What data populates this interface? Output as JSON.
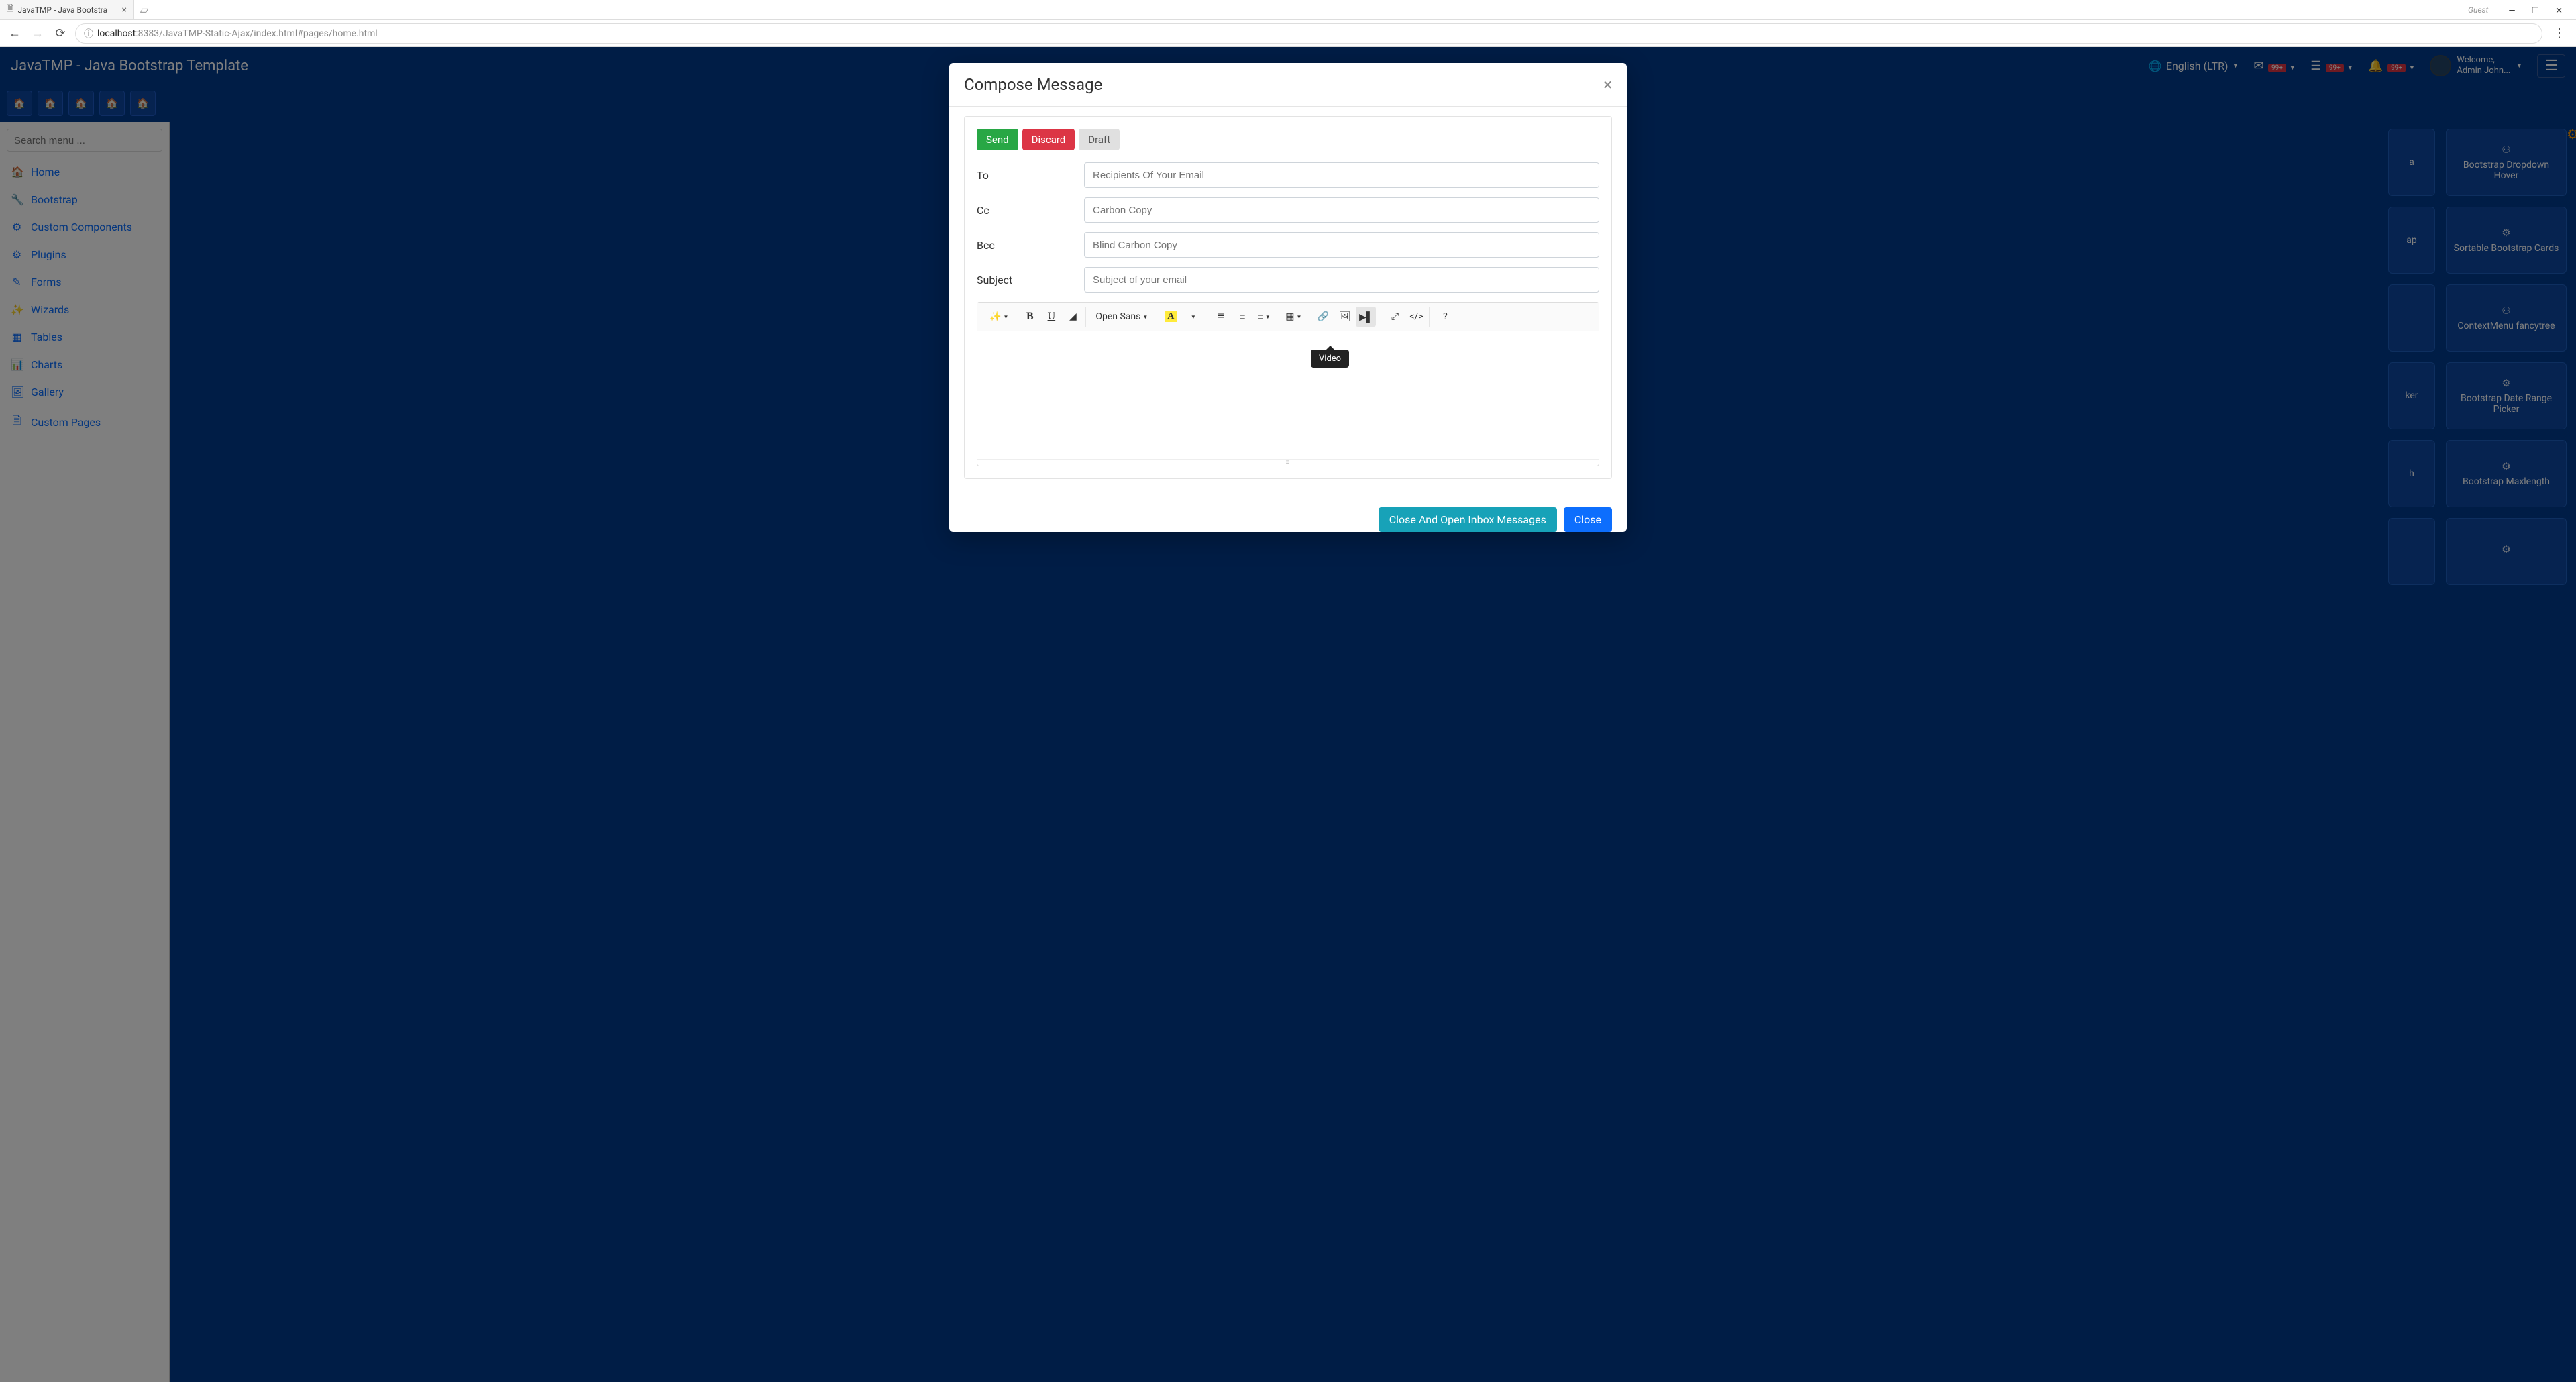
{
  "browser": {
    "tab_title": "JavaTMP - Java Bootstra",
    "guest_label": "Guest",
    "url_host": "localhost",
    "url_path": ":8383/JavaTMP-Static-Ajax/index.html#pages/home.html"
  },
  "topbar": {
    "brand": "JavaTMP - Java Bootstrap Template",
    "language": "English (LTR)",
    "badge": "99+",
    "welcome": "Welcome,",
    "username": "Admin John..."
  },
  "sidebar": {
    "search_placeholder": "Search menu ...",
    "items": [
      {
        "icon": "home",
        "label": "Home"
      },
      {
        "icon": "wrench",
        "label": "Bootstrap"
      },
      {
        "icon": "cog",
        "label": "Custom Components"
      },
      {
        "icon": "cogs",
        "label": "Plugins"
      },
      {
        "icon": "edit",
        "label": "Forms"
      },
      {
        "icon": "magic",
        "label": "Wizards"
      },
      {
        "icon": "table",
        "label": "Tables"
      },
      {
        "icon": "chart",
        "label": "Charts"
      },
      {
        "icon": "image",
        "label": "Gallery"
      },
      {
        "icon": "file",
        "label": "Custom Pages"
      }
    ]
  },
  "cards": {
    "row1": {
      "partial": "a",
      "full": "Bootstrap Dropdown Hover"
    },
    "row2": {
      "partial": "ap",
      "full": "Sortable Bootstrap Cards"
    },
    "row3": {
      "partial": "",
      "full": "ContextMenu fancytree"
    },
    "row4": {
      "partial": "ker",
      "full": "Bootstrap Date Range Picker"
    },
    "row5": {
      "partial": "h",
      "full": "Bootstrap Maxlength"
    },
    "row6": {
      "partial": "",
      "full": ""
    }
  },
  "modal": {
    "title": "Compose Message",
    "buttons": {
      "send": "Send",
      "discard": "Discard",
      "draft": "Draft"
    },
    "labels": {
      "to": "To",
      "cc": "Cc",
      "bcc": "Bcc",
      "subject": "Subject"
    },
    "placeholders": {
      "to": "Recipients Of Your Email",
      "cc": "Carbon Copy",
      "bcc": "Blind Carbon Copy",
      "subject": "Subject of your email"
    },
    "toolbar": {
      "font": "Open Sans"
    },
    "tooltip": "Video",
    "footer": {
      "inbox": "Close And Open Inbox Messages",
      "close": "Close"
    }
  }
}
